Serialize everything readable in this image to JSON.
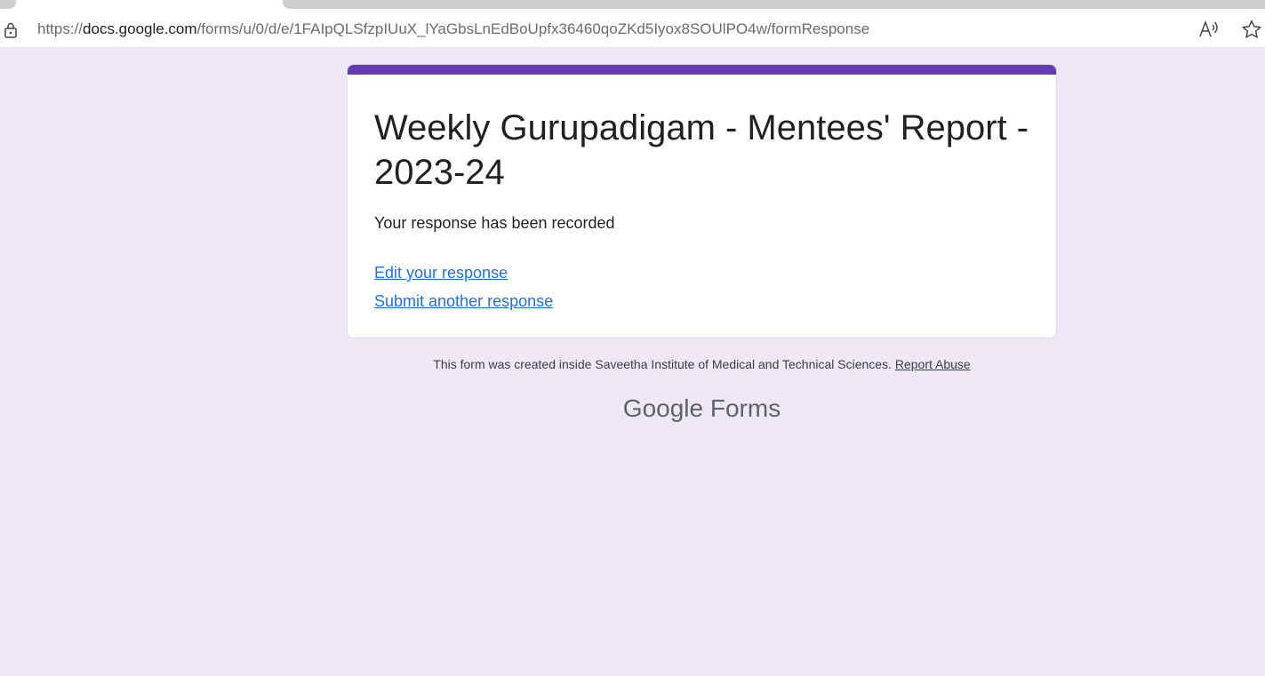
{
  "browser": {
    "url_prefix": "https://",
    "url_host": "docs.google.com",
    "url_path": "/forms/u/0/d/e/1FAIpQLSfzpIUuX_lYaGbsLnEdBoUpfx36460qoZKd5Iyox8SOUlPO4w/formResponse"
  },
  "form": {
    "title": "Weekly Gurupadigam - Mentees' Report - 2023-24",
    "confirmation": "Your response has been recorded",
    "edit_link": "Edit your response",
    "submit_another_link": "Submit another response"
  },
  "footer": {
    "notice": "This form was created inside Saveetha Institute of Medical and Technical Sciences.",
    "report_abuse": "Report Abuse",
    "brand_google": "Google",
    "brand_forms": "Forms"
  },
  "colors": {
    "accent": "#673ab7",
    "background": "#ede7f6",
    "link": "#1a73e8"
  }
}
